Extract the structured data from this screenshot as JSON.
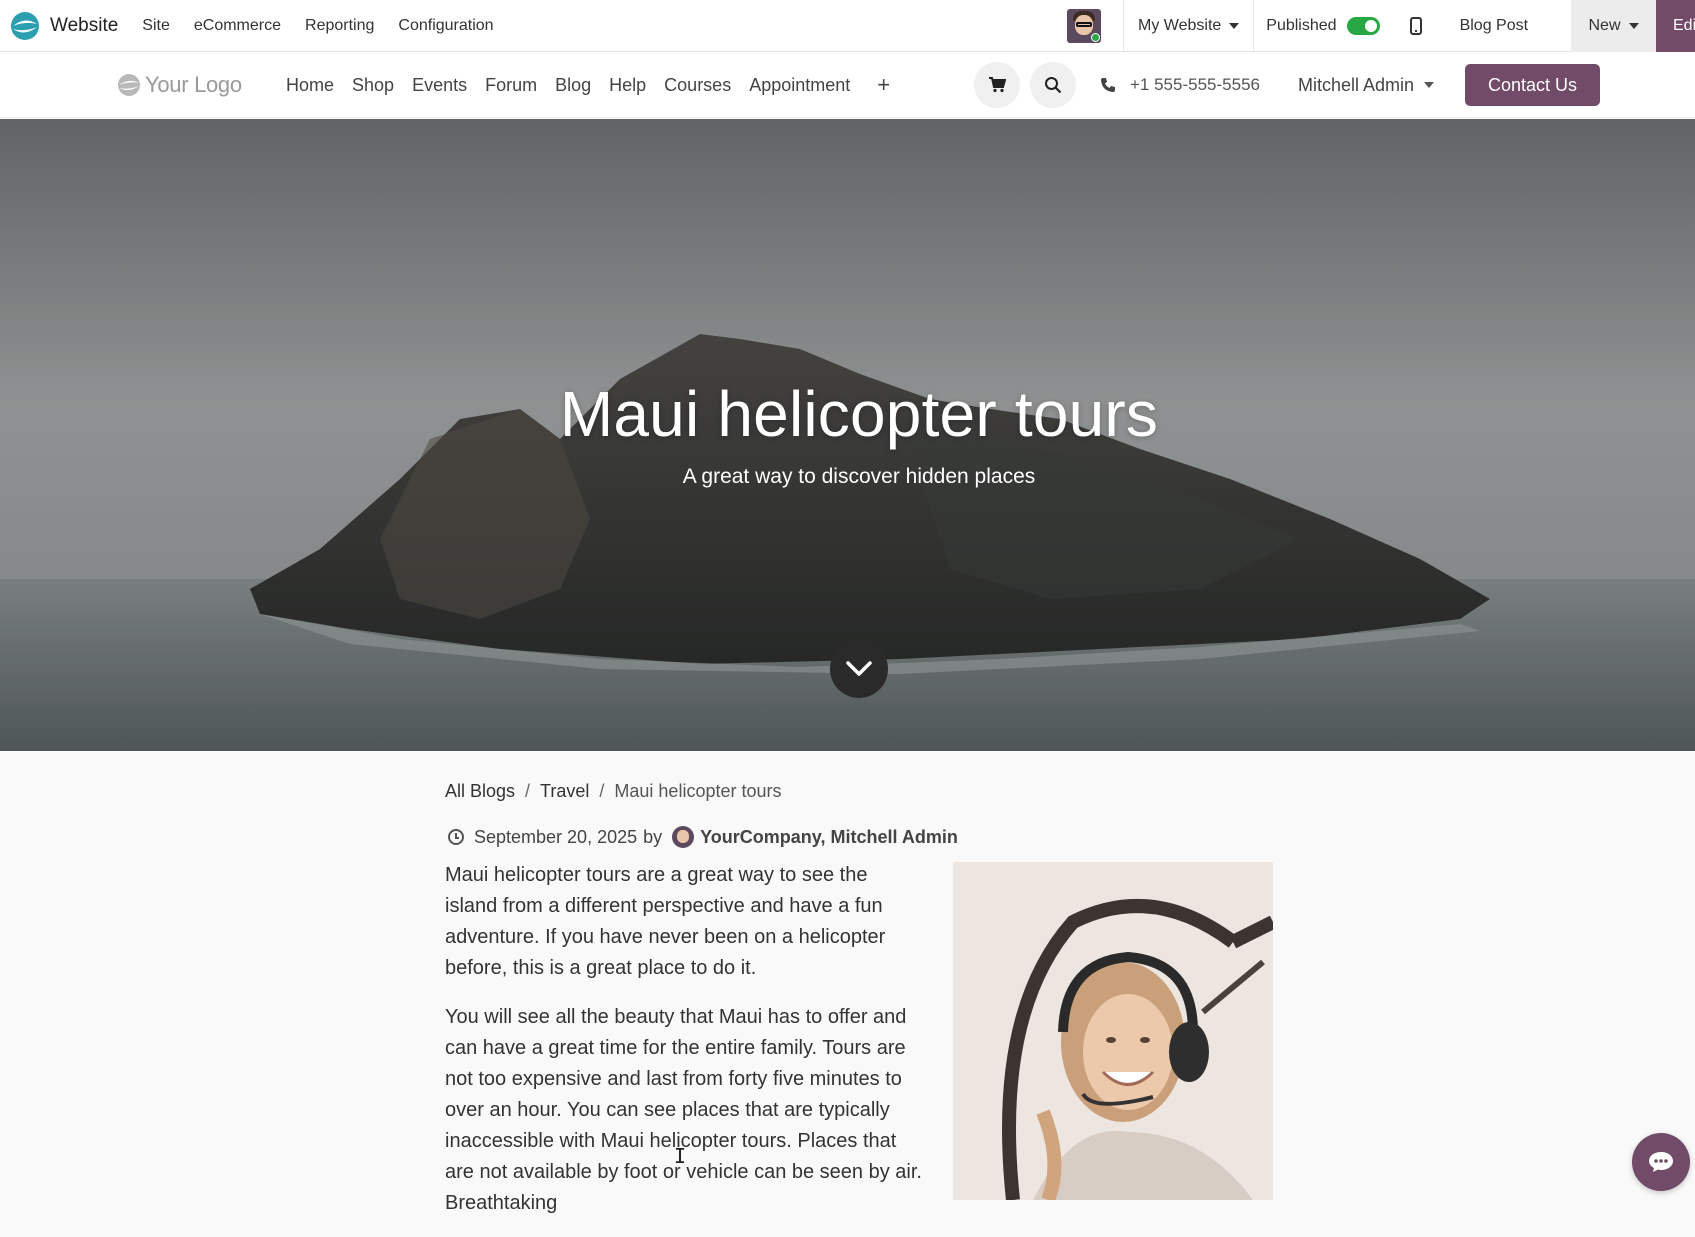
{
  "admin": {
    "app_name": "Website",
    "menu": [
      "Site",
      "eCommerce",
      "Reporting",
      "Configuration"
    ],
    "website_selector": "My Website",
    "published_label": "Published",
    "published": true,
    "blog_post_label": "Blog Post",
    "new_label": "New",
    "edit_label": "Edit"
  },
  "site": {
    "logo_text": "Your Logo",
    "nav": [
      "Home",
      "Shop",
      "Events",
      "Forum",
      "Blog",
      "Help",
      "Courses",
      "Appointment"
    ],
    "add_menu_symbol": "+",
    "phone": "+1 555-555-5556",
    "user": "Mitchell Admin",
    "contact_label": "Contact Us"
  },
  "hero": {
    "title": "Maui helicopter tours",
    "subtitle": "A great way to discover hidden places"
  },
  "article": {
    "breadcrumb": {
      "all_blogs": "All Blogs",
      "separator": "/",
      "category": "Travel",
      "current": "Maui helicopter tours"
    },
    "date": "September 20, 2025",
    "by_label": "by",
    "authors": "YourCompany, Mitchell Admin",
    "paragraphs": [
      "Maui helicopter tours are a great way to see the island from a different perspective and have a fun adventure. If you have never been on a helicopter before, this is a great place to do it.",
      "You will see all the beauty that Maui has to offer and can have a great time for the entire family. Tours are not too expensive and last from forty five minutes to over an hour. You can see places that are typically inaccessible with Maui helicopter tours. Places that are not available by foot or vehicle can be seen by air. Breathtaking"
    ]
  },
  "colors": {
    "brand": "#714B67",
    "published_toggle": "#28a745"
  },
  "icons": [
    "odoo-logo-icon",
    "avatar",
    "caret-down-icon",
    "mobile-preview-icon",
    "cart-icon",
    "search-icon",
    "phone-icon",
    "chevron-down-icon",
    "clock-icon",
    "chat-icon"
  ]
}
